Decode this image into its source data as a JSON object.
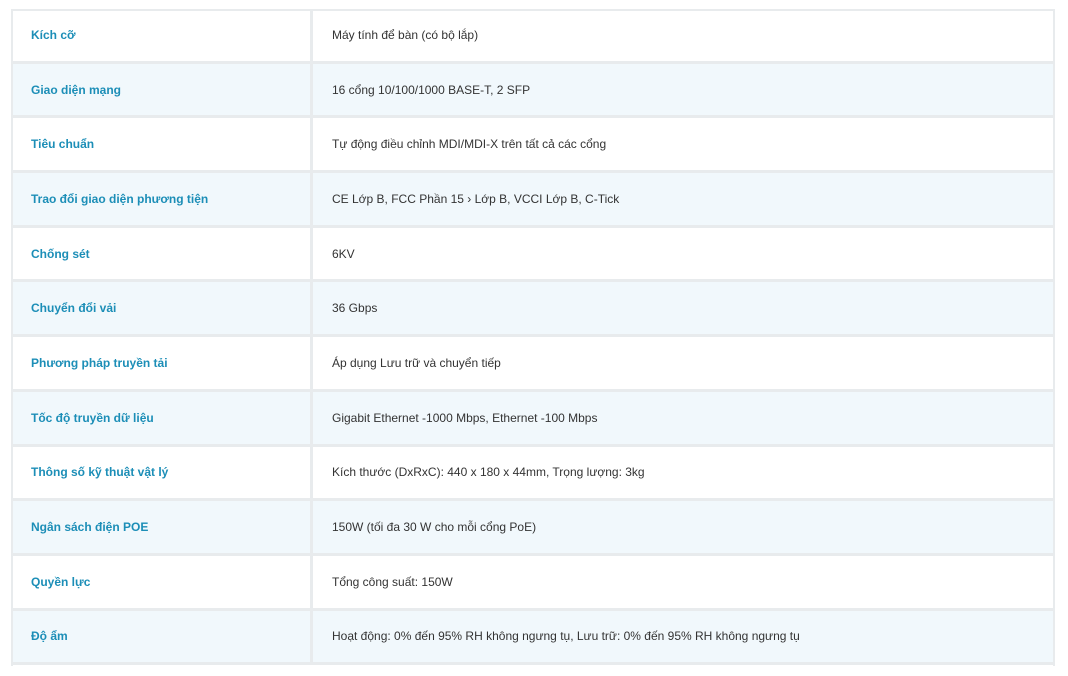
{
  "specs": [
    {
      "label": "Kích cỡ",
      "value": "Máy tính để bàn (có bộ lắp)"
    },
    {
      "label": "Giao diện mạng",
      "value": "16 cổng 10/100/1000 BASE-T, 2 SFP"
    },
    {
      "label": "Tiêu chuẩn",
      "value": "Tự động điều chỉnh MDI/MDI-X trên tất cả các cổng"
    },
    {
      "label": "Trao đổi giao diện phương tiện",
      "value": "CE Lớp B, FCC Phần 15 › Lớp B, VCCI Lớp B, C-Tick"
    },
    {
      "label": "Chống sét",
      "value": "6KV"
    },
    {
      "label": "Chuyển đổi vải",
      "value": "36 Gbps"
    },
    {
      "label": "Phương pháp truyền tải",
      "value": "Áp dụng Lưu trữ và chuyển tiếp"
    },
    {
      "label": "Tốc độ truyền dữ liệu",
      "value": "Gigabit Ethernet -1000 Mbps, Ethernet -100 Mbps"
    },
    {
      "label": "Thông số kỹ thuật vật lý",
      "value": "Kích thước (DxRxC): 440 x 180 x 44mm, Trọng lượng: 3kg"
    },
    {
      "label": "Ngân sách điện POE",
      "value": "150W (tối đa 30 W cho mỗi cổng PoE)"
    },
    {
      "label": "Quyền lực",
      "value": "Tổng công suất: 150W"
    },
    {
      "label": "Độ ẩm",
      "value": "Hoạt động: 0% đến 95% RH không ngưng tụ, Lưu trữ: 0% đến 95% RH không ngưng tụ"
    }
  ],
  "colors": {
    "label": "#1c8eb7",
    "value": "#333333",
    "row_alt": "#f1f8fc",
    "border": "#e8ebed"
  }
}
